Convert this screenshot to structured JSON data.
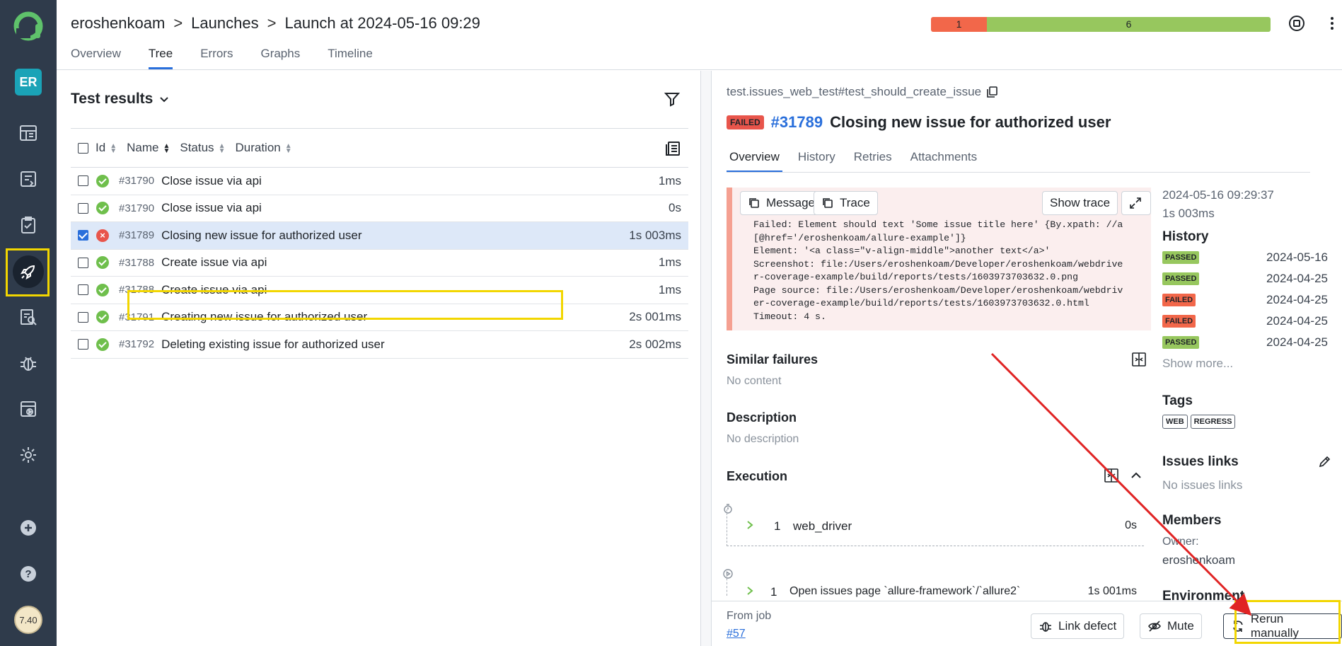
{
  "sidebar": {
    "badge": "ER",
    "avatar_text": "7.40",
    "items": [
      "dashboards",
      "test-cases",
      "test-plans",
      "launches",
      "analytics",
      "defects",
      "jobs",
      "settings",
      "add",
      "help"
    ]
  },
  "header": {
    "breadcrumb": [
      "eroshenkoam",
      "Launches",
      "Launch at 2024-05-16 09:29"
    ],
    "separator": ">",
    "tabs": [
      "Overview",
      "Tree",
      "Errors",
      "Graphs",
      "Timeline"
    ],
    "active_tab": "Tree",
    "stats": {
      "failed": "1",
      "passed": "6"
    }
  },
  "tree": {
    "title": "Test results",
    "columns": [
      "Id",
      "Name",
      "Status",
      "Duration"
    ],
    "rows": [
      {
        "id": "#31790",
        "name": "Close issue via api",
        "duration": "1ms",
        "status": "passed",
        "checked": false
      },
      {
        "id": "#31790",
        "name": "Close issue via api",
        "duration": "0s",
        "status": "passed",
        "checked": false
      },
      {
        "id": "#31789",
        "name": "Closing new issue for authorized user",
        "duration": "1s 003ms",
        "status": "failed",
        "checked": true
      },
      {
        "id": "#31788",
        "name": "Create issue via api",
        "duration": "1ms",
        "status": "passed",
        "checked": false
      },
      {
        "id": "#31788",
        "name": "Create issue via api",
        "duration": "1ms",
        "status": "passed",
        "checked": false
      },
      {
        "id": "#31791",
        "name": "Creating new issue for authorized user",
        "duration": "2s 001ms",
        "status": "passed",
        "checked": false
      },
      {
        "id": "#31792",
        "name": "Deleting existing issue for authorized user",
        "duration": "2s 002ms",
        "status": "passed",
        "checked": false
      }
    ]
  },
  "detail": {
    "path": "test.issues_web_test#test_should_create_issue",
    "status_badge": "FAILED",
    "id": "#31789",
    "title": "Closing new issue for authorized user",
    "tabs": [
      "Overview",
      "History",
      "Retries",
      "Attachments"
    ],
    "active_tab": "Overview",
    "buttons": {
      "message": "Message",
      "trace": "Trace",
      "show_trace": "Show trace"
    },
    "error_text": "Failed: Element should text 'Some issue title here' {By.xpath: //a\n[@href='/eroshenkoam/allure-example']}\nElement: '<a class=\"v-align-middle\">another text</a>'\nScreenshot: file:/Users/eroshenkoam/Developer/eroshenkoam/webdrive\nr-coverage-example/build/reports/tests/1603973703632.0.png\nPage source: file:/Users/eroshenkoam/Developer/eroshenkoam/webdriv\ner-coverage-example/build/reports/tests/1603973703632.0.html\nTimeout: 4 s.",
    "similar_failures": {
      "title": "Similar failures",
      "value": "No content"
    },
    "description": {
      "title": "Description",
      "value": "No description"
    },
    "execution": {
      "title": "Execution",
      "steps": [
        {
          "num": "1",
          "name": "web_driver",
          "duration": "0s"
        },
        {
          "num": "1",
          "name": "Open issues page `allure-framework`/`allure2`",
          "duration": "1s 001ms"
        }
      ]
    },
    "side": {
      "date": "2024-05-16 09:29:37",
      "duration": "1s 003ms",
      "history_title": "History",
      "history": [
        {
          "status": "PASSED",
          "date": "2024-05-16"
        },
        {
          "status": "PASSED",
          "date": "2024-04-25"
        },
        {
          "status": "FAILED",
          "date": "2024-04-25"
        },
        {
          "status": "FAILED",
          "date": "2024-04-25"
        },
        {
          "status": "PASSED",
          "date": "2024-04-25"
        }
      ],
      "show_more": "Show more...",
      "tags_title": "Tags",
      "tags": [
        "WEB",
        "REGRESS"
      ],
      "issues_title": "Issues links",
      "issues_value": "No issues links",
      "members_title": "Members",
      "owner_label": "Owner:",
      "owner": "eroshenkoam",
      "environment_title": "Environment"
    },
    "footer": {
      "from_job": "From job",
      "job_link": "#57",
      "link_defect": "Link defect",
      "mute": "Mute",
      "rerun": "Rerun manually"
    }
  },
  "colors": {
    "accent": "#2a6fdb",
    "failed": "#f2674a",
    "passed": "#97c75e",
    "sidebar": "#2f3b4b",
    "highlight": "#f2d600",
    "annotation_arrow": "#e02424"
  }
}
